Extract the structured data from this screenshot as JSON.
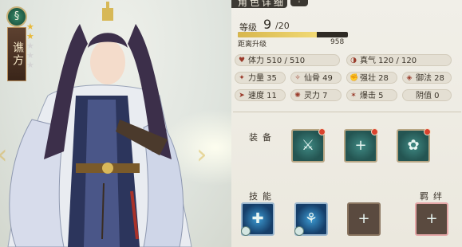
{
  "hero": {
    "name": "谯方",
    "stars_on": 2,
    "stars_total": 5,
    "emblem_glyph": "§"
  },
  "panel": {
    "title": "角色详细",
    "info_button": "!"
  },
  "level": {
    "label": "等级",
    "current": "9",
    "max": "/20",
    "xp_label": "距离升级",
    "xp_value": "958",
    "xp_fill_fraction": 0.72
  },
  "stats": [
    {
      "icon": "heart-icon",
      "glyph": "♥",
      "label": "体力",
      "value": "510 / 510"
    },
    {
      "icon": "spirit-icon",
      "glyph": "◑",
      "label": "真气",
      "value": "120 / 120"
    },
    {
      "icon": "power-icon",
      "glyph": "✦",
      "label": "力量",
      "value": "35"
    },
    {
      "icon": "bone-icon",
      "glyph": "✧",
      "label": "仙骨",
      "value": "49"
    },
    {
      "icon": "fist-icon",
      "glyph": "✊",
      "label": "强壮",
      "value": "28"
    },
    {
      "icon": "magic-icon",
      "glyph": "◈",
      "label": "御法",
      "value": "28"
    },
    {
      "icon": "speed-icon",
      "glyph": "➤",
      "label": "速度",
      "value": "11"
    },
    {
      "icon": "soul-icon",
      "glyph": "✺",
      "label": "灵力",
      "value": "7"
    },
    {
      "icon": "crit-icon",
      "glyph": "✶",
      "label": "爆击",
      "value": "5"
    },
    {
      "icon": "yin-icon",
      "glyph": "",
      "label": "阴值",
      "value": "0"
    }
  ],
  "equipment": {
    "label": "装备",
    "slots": [
      {
        "kind": "teal",
        "glyph": "⚔",
        "icon": "sword-icon",
        "dot": true
      },
      {
        "kind": "teal",
        "glyph": "+",
        "icon": "plus-icon",
        "dot": true
      },
      {
        "kind": "teal",
        "glyph": "✿",
        "icon": "flower-icon",
        "dot": true
      }
    ]
  },
  "skills": {
    "label": "技能",
    "slots": [
      {
        "kind": "blue",
        "glyph": "✚",
        "icon": "skill-rune-icon",
        "badge": true
      },
      {
        "kind": "blue",
        "glyph": "⚘",
        "icon": "skill-aura-icon",
        "badge": true
      },
      {
        "kind": "empty",
        "glyph": "+",
        "icon": "plus-icon",
        "badge": false
      }
    ]
  },
  "bond": {
    "label": "羁绊",
    "slot": {
      "kind": "pink",
      "glyph": "+",
      "icon": "plus-icon"
    }
  },
  "colors": {
    "accent_gold": "#e8b93a",
    "xp_fill": "#d7b64c",
    "alert_dot": "#d9432e"
  }
}
